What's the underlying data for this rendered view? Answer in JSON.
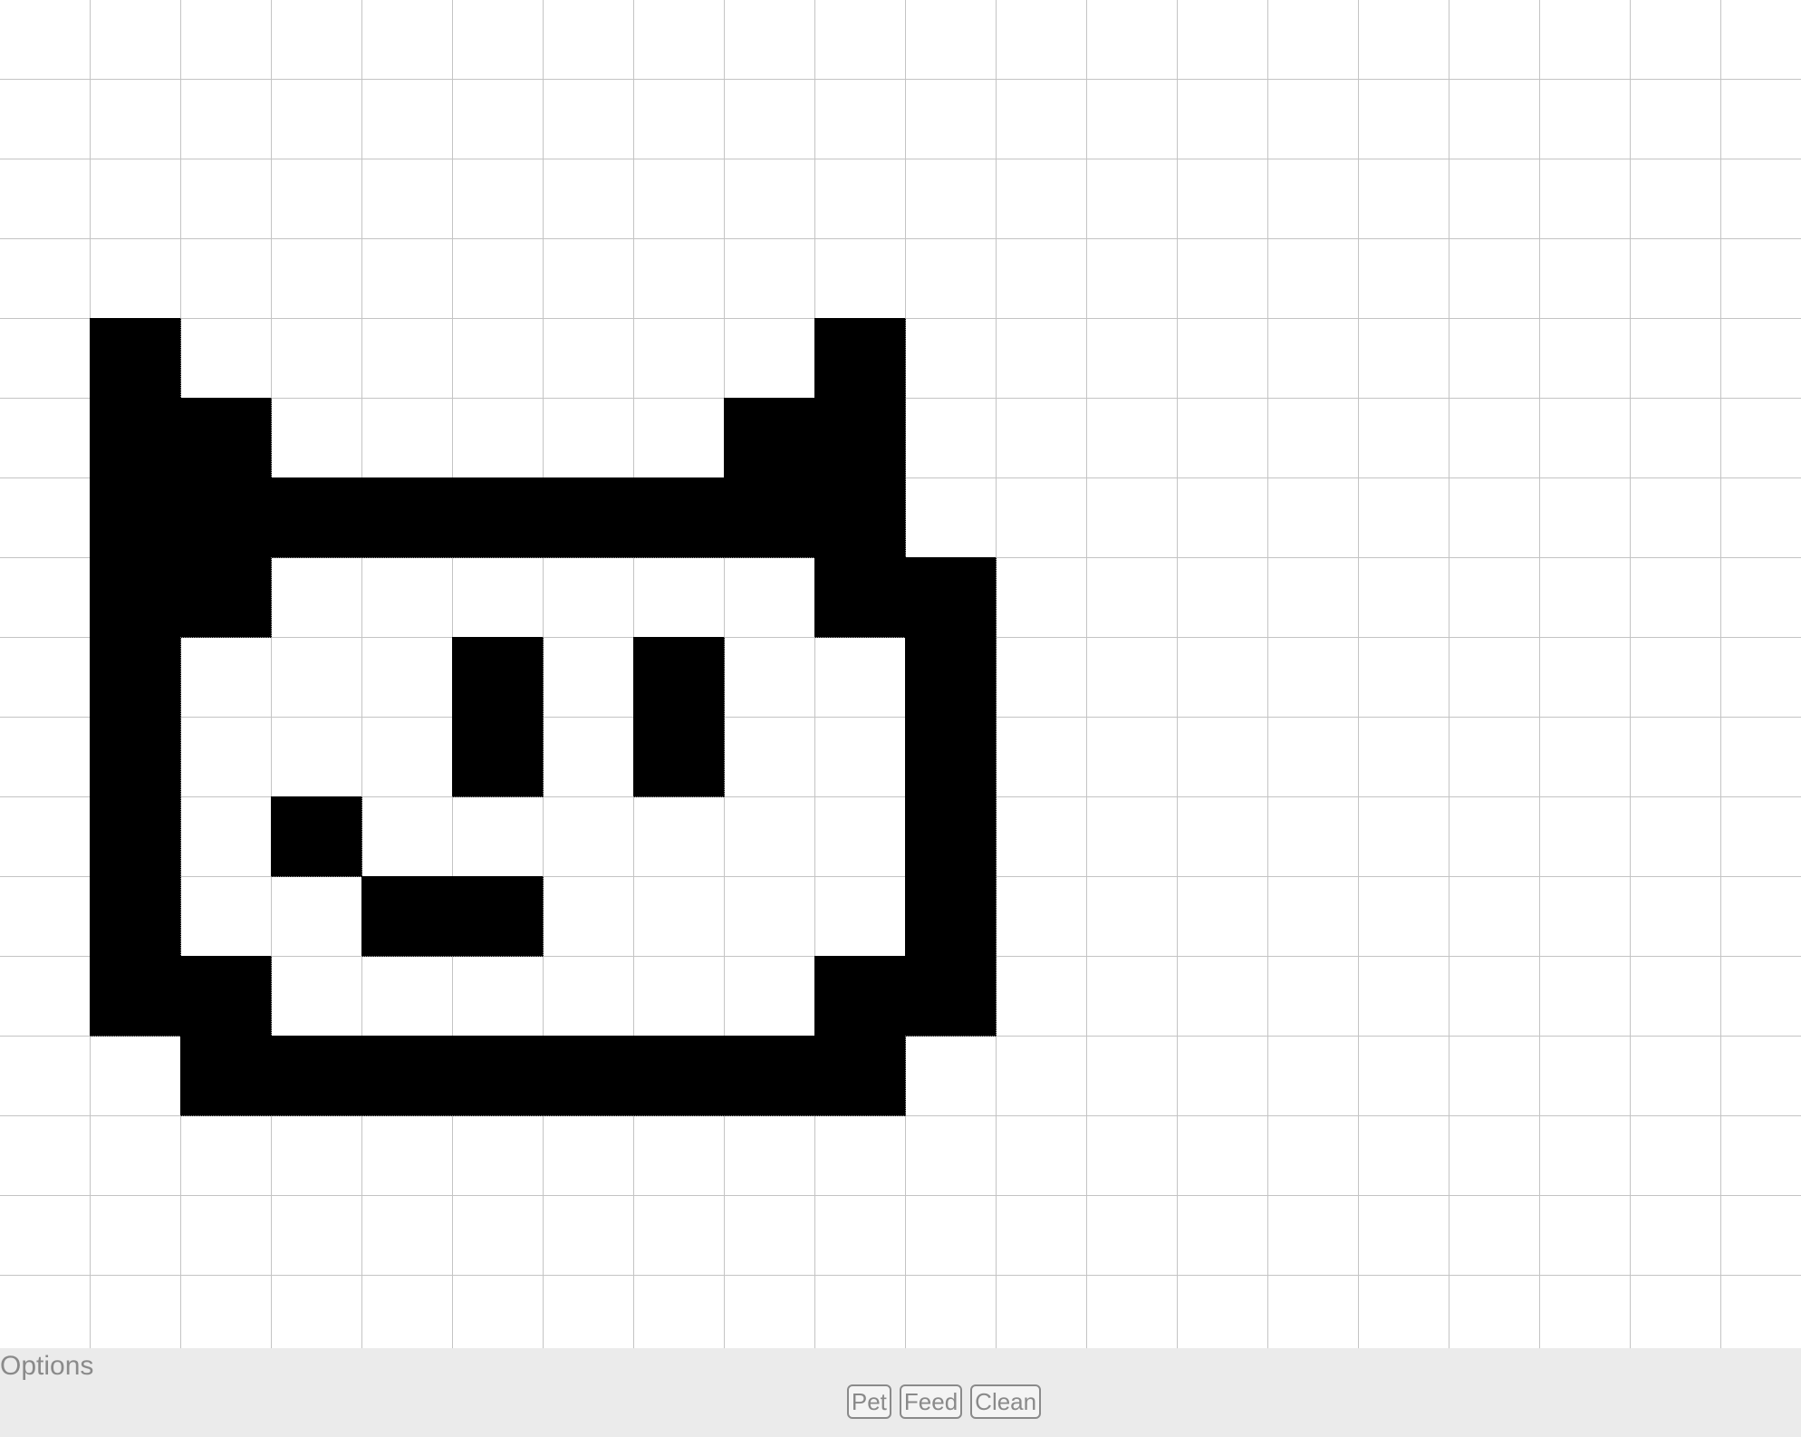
{
  "options": {
    "title": "Options",
    "buttons": [
      {
        "label": "Pet"
      },
      {
        "label": "Feed"
      },
      {
        "label": "Clean"
      }
    ]
  },
  "colors": {
    "pixel_on": "#000000",
    "pixel_off": "#ffffff",
    "grid_line": "#c4c4c4",
    "panel_bg": "#ebebeb",
    "panel_text": "#8a8a8a"
  },
  "sprite": {
    "name": "pet",
    "rows": [
      "..........",
      "..........",
      "..........",
      "..........",
      ".X.......X",
      ".XX.....XX",
      ".XXXXXXXXX",
      ".XX......XX",
      ".X...X.X..X",
      ".X...X.X..X",
      ".X.X......X",
      ".X..XX....X",
      ".XX......XX",
      "..XXXXXXXX.",
      "..........."
    ]
  }
}
